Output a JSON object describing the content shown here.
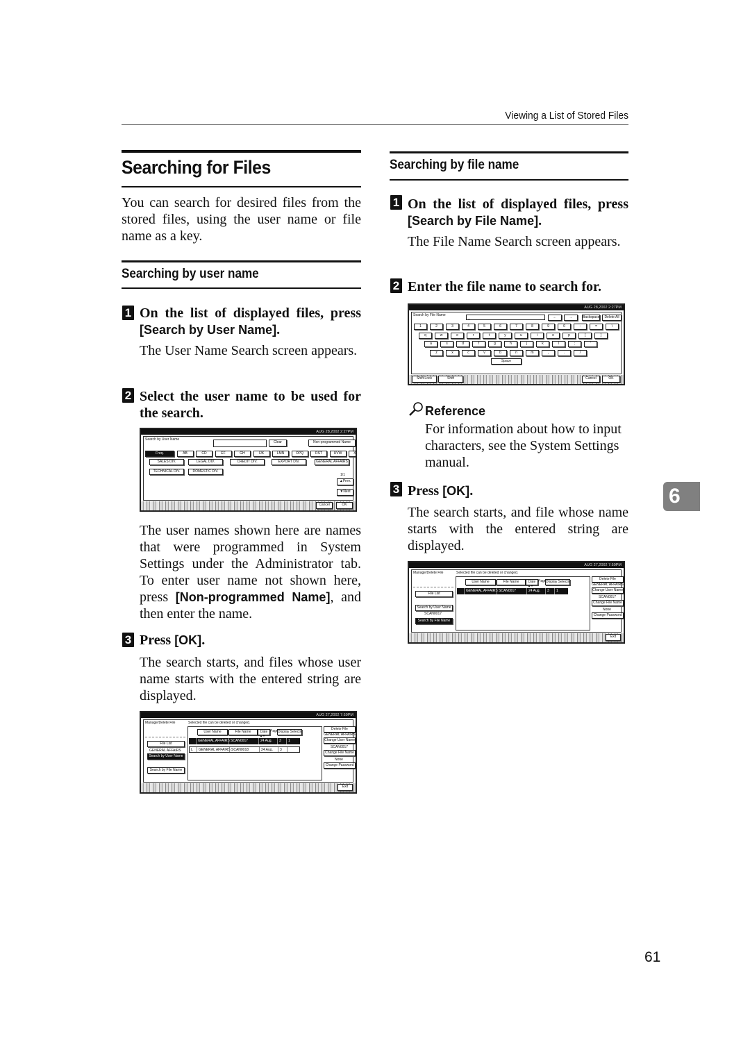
{
  "running_head": "Viewing a List of Stored Files",
  "chapter_tab": "6",
  "page_number": "61",
  "left": {
    "title": "Searching for Files",
    "intro": "You can search for desired files from the stored files, using the user name or file name as a key.",
    "section": {
      "heading": "Searching by user name",
      "steps": [
        {
          "num": "1",
          "text_pre": "On the list of displayed files, press ",
          "key": "[Search by User Name]",
          "text_post": ".",
          "note": "The User Name Search screen appears."
        },
        {
          "num": "2",
          "text_pre": "Select the user name to be used for the search.",
          "key": "",
          "text_post": ""
        },
        {
          "num": "3",
          "text_pre": "Press ",
          "key": "[OK]",
          "text_post": ".",
          "note": "The search starts, and files whose user name starts with the entered string are displayed."
        }
      ],
      "explain_pre": "The user names shown here are names that were programmed in System Settings under the Administrator tab. To enter user name not shown here, press ",
      "explain_key": "[Non-programmed Name]",
      "explain_post": ", and then enter the name."
    },
    "screen_user_search": {
      "datetime": "AUG 28,2002 2:27PM",
      "title": "Search by User Name",
      "clear": "Clear",
      "non_programmed": "Non-programmed Name",
      "tabs": [
        "Freq.",
        "AB",
        "CD",
        "EF",
        "GH",
        "IJK",
        "LMN",
        "OPQ",
        "RST",
        "UVW",
        "XYZ"
      ],
      "active_tab": "Freq.",
      "names": [
        "SALES DIV.",
        "LEGAL DIV.",
        "CREDIT DIV.",
        "EXPORT DIV.",
        "GENERAL AFFAIRS",
        "TECHNICAL DIV.",
        "DOMESTIC DIV."
      ],
      "page": "1/1",
      "prev": "▲Prev.",
      "next": "▼Next",
      "cancel": "Cancel",
      "ok": "OK"
    },
    "screen_user_result": {
      "datetime": "AUG 27,2002 7:59PM",
      "title": "Manage/Delete File",
      "message": "Selected file can be deleted or changed.",
      "columns": [
        "User Name",
        "File Name",
        "Date",
        "Pages",
        "Display Selection"
      ],
      "rows": [
        {
          "sel": "",
          "user": "GENERAL AFFAIRS",
          "file": "SCAN0017",
          "date": "24 Aug.",
          "pages": "3",
          "order": "1",
          "selected": true
        },
        {
          "sel": "L",
          "user": "GENERAL AFFAIRS",
          "file": "SCAN0018",
          "date": "24 Aug.",
          "pages": "3",
          "order": "",
          "selected": false
        }
      ],
      "file_list": "File List",
      "search_user_value": "GENERAL AFFAIRS",
      "search_by_user": "Search by User Name",
      "search_by_file": "Search by File Name",
      "delete_file": "Delete File",
      "cur_user": "GENERAL AFFAIRS",
      "change_user": "Change User Name",
      "cur_file": "SCAN0017",
      "change_file": "Change File Name",
      "cur_password": "None",
      "change_password": "Change Password",
      "exit": "Exit"
    }
  },
  "right": {
    "section": {
      "heading": "Searching by file name",
      "steps": [
        {
          "num": "1",
          "text_pre": "On the list of displayed files, press ",
          "key": "[Search by File Name]",
          "text_post": ".",
          "note": "The File Name Search screen appears."
        },
        {
          "num": "2",
          "text_pre": "Enter the file name to search for.",
          "key": "",
          "text_post": ""
        },
        {
          "num": "3",
          "text_pre": "Press ",
          "key": "[OK]",
          "text_post": ".",
          "note": "The search starts, and file whose name starts with the entered string are displayed."
        }
      ],
      "reference_label": "Reference",
      "reference_text": "For information about how to input characters, see the System Settings manual."
    },
    "screen_file_search": {
      "datetime": "AUG 28,2002 2:27PM",
      "title": "Search by File Name",
      "input_value": "_",
      "left_arrow": "←",
      "right_arrow": "→",
      "backspace": "Backspace",
      "delete_all": "Delete All",
      "rows": [
        [
          "1",
          "2",
          "3",
          "4",
          "5",
          "6",
          "7",
          "8",
          "9",
          "0",
          "-",
          "=",
          "\\"
        ],
        [
          "q",
          "w",
          "e",
          "r",
          "t",
          "y",
          "u",
          "i",
          "o",
          "p",
          "[",
          "]"
        ],
        [
          "a",
          "s",
          "d",
          "f",
          "g",
          "h",
          "j",
          "k",
          "l",
          ";",
          "'"
        ],
        [
          "z",
          "x",
          "c",
          "v",
          "b",
          "n",
          "m",
          ",",
          ".",
          "/"
        ]
      ],
      "space": "Space",
      "shift_lock": "Shift Lock",
      "shift": "Shift",
      "cancel": "Cancel",
      "ok": "OK"
    },
    "screen_file_result": {
      "datetime": "AUG 27,2002 7:59PM",
      "title": "Manage/Delete File",
      "message": "Selected file can be deleted or changed.",
      "columns": [
        "User Name",
        "File Name",
        "Date",
        "Pages",
        "Display Selection"
      ],
      "rows": [
        {
          "sel": "",
          "user": "GENERAL AFFAIRS",
          "file": "SCAN0017",
          "date": "24 Aug.",
          "pages": "3",
          "order": "1",
          "selected": true
        }
      ],
      "file_list": "File List",
      "search_by_user": "Search by User Name",
      "search_file_value": "SCAN0017",
      "search_by_file": "Search by File Name",
      "delete_file": "Delete File",
      "cur_user": "GENERAL AFFAIRS",
      "change_user": "Change User Name",
      "cur_file": "SCAN0017",
      "change_file": "Change File Name",
      "cur_password": "None",
      "change_password": "Change Password",
      "exit": "Exit"
    }
  }
}
